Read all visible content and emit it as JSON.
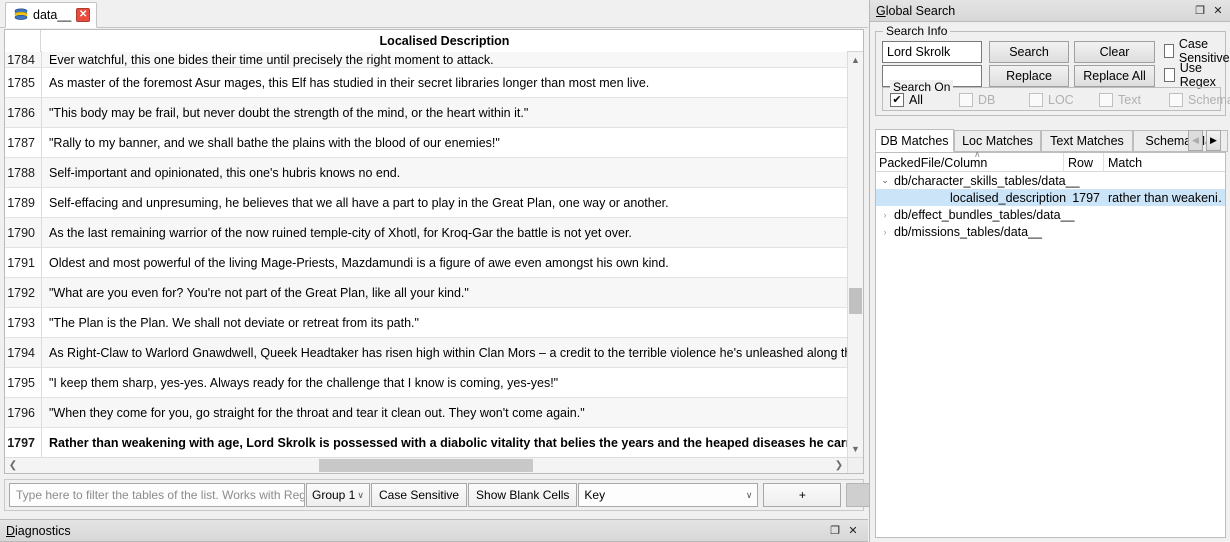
{
  "left": {
    "tab": {
      "label": "data__",
      "icon": "database-icon",
      "close_label": "✕"
    },
    "table": {
      "header_index": "",
      "header_description": "Localised Description",
      "rows": [
        {
          "id": "1784",
          "text": "Ever watchful, this one bides their time until precisely the right moment to attack."
        },
        {
          "id": "1785",
          "text": "As master of the foremost Asur mages, this Elf has studied in their secret libraries longer than most men live."
        },
        {
          "id": "1786",
          "text": "\"This body may be frail, but never doubt the strength of the mind, or the heart within it.\""
        },
        {
          "id": "1787",
          "text": "\"Rally to my banner, and we shall bathe the plains with the blood of our enemies!\""
        },
        {
          "id": "1788",
          "text": "Self-important and opinionated, this one's hubris knows no end."
        },
        {
          "id": "1789",
          "text": "Self-effacing and unpresuming, he believes that we all have a part to play in the Great Plan, one way or another."
        },
        {
          "id": "1790",
          "text": "As the last remaining warrior of the now ruined temple-city of Xhotl, for Kroq-Gar the battle is not yet over."
        },
        {
          "id": "1791",
          "text": "Oldest and most powerful of the living Mage-Priests, Mazdamundi is a figure of awe even amongst his own kind."
        },
        {
          "id": "1792",
          "text": "\"What are you even for? You're not part of the Great Plan, like all your kind.\""
        },
        {
          "id": "1793",
          "text": "\"The Plan is the Plan. We shall not deviate or retreat from its path.\""
        },
        {
          "id": "1794",
          "text": "As Right-Claw to Warlord Gnawdwell, Queek Headtaker has risen high within Clan Mors – a credit to the terrible violence he's unleashed along the way."
        },
        {
          "id": "1795",
          "text": "\"I keep them sharp, yes-yes. Always ready for the challenge that I know is coming, yes-yes!\""
        },
        {
          "id": "1796",
          "text": "\"When they come for you, go straight for the throat and tear it clean out. They won't come again.\""
        },
        {
          "id": "1797",
          "text": "Rather than weakening with age, Lord Skrolk is possessed with a diabolic vitality that belies the years and the heaped diseases he carries."
        }
      ]
    },
    "scrollbars": {
      "v_up": "▲",
      "v_down": "▼",
      "h_left": "❮",
      "h_right": "❯"
    },
    "filter_bar": {
      "filter_placeholder": "Type here to filter the tables of the list. Works with Rege…",
      "filter_value": "",
      "group_value": "Group 1",
      "case_sensitive_label": "Case Sensitive",
      "show_blank_cells_label": "Show Blank Cells",
      "key_value": "Key",
      "add_label": "+",
      "remove_label": "-",
      "caret": "∨"
    },
    "diagnostics": {
      "title_mnemonic": "D",
      "title_rest": "iagnostics",
      "float_label": "❐",
      "close_label": "✕"
    }
  },
  "right": {
    "titlebar": {
      "title_mnemonic": "G",
      "title_rest": "lobal Search",
      "float_label": "❐",
      "close_label": "✕"
    },
    "search_info": {
      "group_label": "Search Info",
      "search_value": "Lord Skrolk",
      "replace_value": "",
      "search_button": "Search",
      "clear_button": "Clear",
      "replace_button": "Replace",
      "replace_all_button": "Replace All",
      "case_sensitive_label": "Case Sensitive",
      "case_sensitive_checked": "",
      "use_regex_label": "Use Regex",
      "use_regex_checked": ""
    },
    "search_on": {
      "group_label": "Search On",
      "options": [
        {
          "label": "All",
          "checked": "✔",
          "enabled": true
        },
        {
          "label": "DB",
          "checked": "",
          "enabled": false
        },
        {
          "label": "LOC",
          "checked": "",
          "enabled": false
        },
        {
          "label": "Text",
          "checked": "",
          "enabled": false
        },
        {
          "label": "Schemas",
          "checked": "",
          "enabled": false
        }
      ]
    },
    "tabs": [
      {
        "label": "DB Matches",
        "active": true
      },
      {
        "label": "Loc Matches",
        "active": false
      },
      {
        "label": "Text Matches",
        "active": false
      },
      {
        "label": "Schema Mat",
        "active": false
      }
    ],
    "tab_nav": {
      "prev": "◀",
      "next": "▶"
    },
    "tree": {
      "columns": {
        "file": "PackedFile/Column",
        "row": "Row",
        "match": "Match"
      },
      "sort_indicator": "∧",
      "nodes": [
        {
          "arrow": "⌄",
          "expanded": true,
          "label": "db/character_skills_tables/data__",
          "row": "",
          "match": "",
          "selected": false,
          "child": false
        },
        {
          "arrow": "",
          "expanded": false,
          "label": "localised_description",
          "row": "1797",
          "match": "rather than weakeni…",
          "selected": true,
          "child": true
        },
        {
          "arrow": "›",
          "expanded": false,
          "label": "db/effect_bundles_tables/data__",
          "row": "",
          "match": "",
          "selected": false,
          "child": false
        },
        {
          "arrow": "›",
          "expanded": false,
          "label": "db/missions_tables/data__",
          "row": "",
          "match": "",
          "selected": false,
          "child": false
        }
      ]
    }
  },
  "colors": {
    "selection": "#cce4f7",
    "tab_close_red": "#e74c3c",
    "window_bg": "#f0f0f0"
  }
}
